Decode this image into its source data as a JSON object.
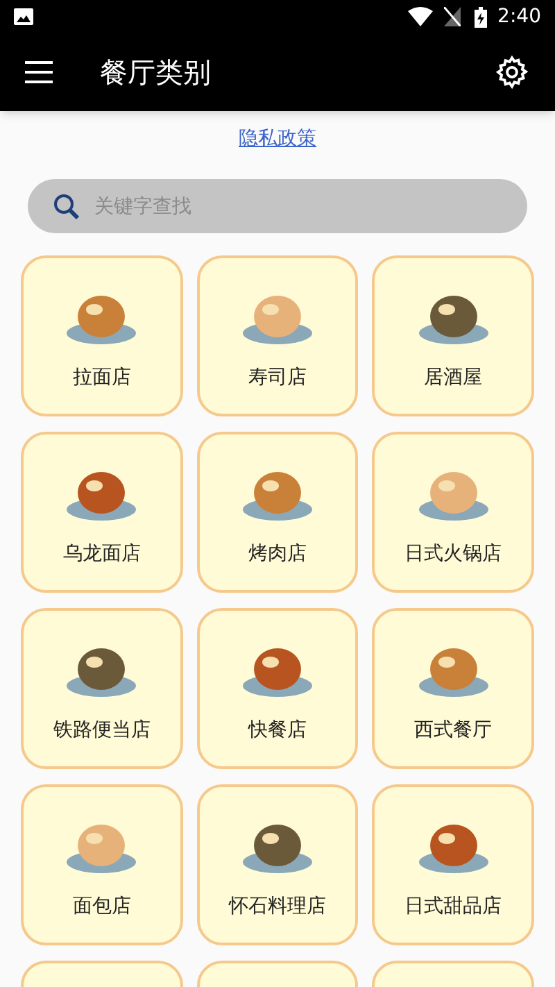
{
  "status_bar": {
    "time": "2:40"
  },
  "app_bar": {
    "title": "餐厅类别"
  },
  "privacy_link": "隐私政策",
  "search": {
    "placeholder": "关键字查找"
  },
  "categories": [
    {
      "label": "拉面店"
    },
    {
      "label": "寿司店"
    },
    {
      "label": "居酒屋"
    },
    {
      "label": "乌龙面店"
    },
    {
      "label": "烤肉店"
    },
    {
      "label": "日式火锅店"
    },
    {
      "label": "铁路便当店"
    },
    {
      "label": "快餐店"
    },
    {
      "label": "西式餐厅"
    },
    {
      "label": "面包店"
    },
    {
      "label": "怀石料理店"
    },
    {
      "label": "日式甜品店"
    }
  ]
}
